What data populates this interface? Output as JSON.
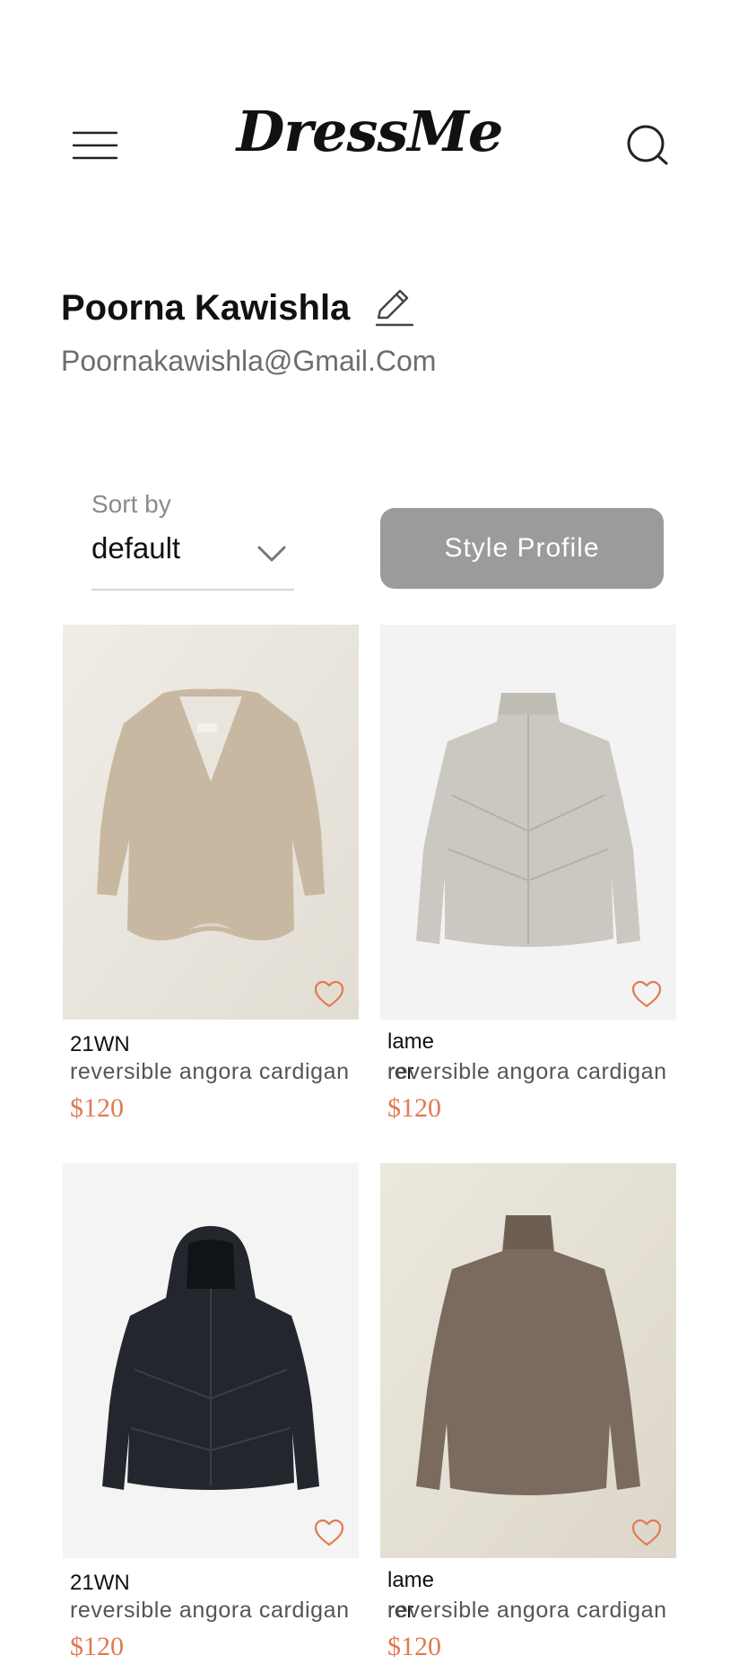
{
  "header": {
    "logo": "DressMe",
    "menu_icon": "hamburger-menu-icon",
    "search_icon": "search-icon"
  },
  "profile": {
    "name": "Poorna Kawishla",
    "email": "Poornakawishla@Gmail.Com",
    "edit_icon": "pencil-edit-icon"
  },
  "controls": {
    "sort_label": "Sort by",
    "sort_value": "default",
    "style_button_label": "Style Profile"
  },
  "colors": {
    "accent": "#e07a52",
    "button_bg": "#9b9b9b"
  },
  "products": [
    {
      "brand": "21WN",
      "description": "reversible angora cardigan",
      "price": "$120",
      "image": "beige-wool-cardigan",
      "favorite_icon": "heart-outline-icon"
    },
    {
      "brand": "lame\nrer",
      "description": "reversible angora cardigan",
      "price": "$120",
      "image": "light-gray-puffer-jacket",
      "favorite_icon": "heart-outline-icon"
    },
    {
      "brand": "21WN",
      "description": "reversible angora cardigan",
      "price": "$120",
      "image": "black-hooded-down-jacket",
      "favorite_icon": "heart-outline-icon"
    },
    {
      "brand": "lame\nrer",
      "description": "reversible angora cardigan",
      "price": "$120",
      "image": "brown-turtleneck-sweater",
      "favorite_icon": "heart-outline-icon"
    }
  ]
}
